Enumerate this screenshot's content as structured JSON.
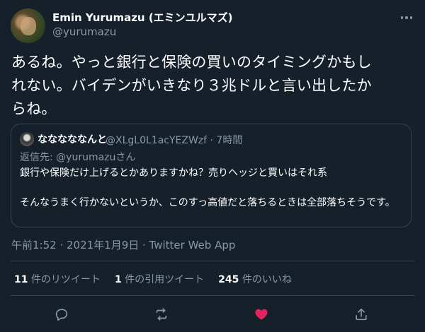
{
  "author": {
    "name": "Emin Yurumazu (エミンユルマズ)",
    "handle": "@yurumazu"
  },
  "tweet": {
    "lines": [
      "あるね。やっと銀行と保険の買いのタイミングかもし",
      "れない。バイデンがいきなり３兆ドルと言い出したか",
      "らね。"
    ]
  },
  "quote": {
    "name": "なななななんと",
    "handle_time": "@XLgL0L1acYEZWzf · 7時間",
    "reply_prefix": "返信先: ",
    "reply_mention": "@yurumazu",
    "reply_suffix": "さん",
    "paragraphs": [
      "銀行や保険だけ上げるとかありますかね？売りヘッジと買いはそれ系",
      "そんなうまく行かないというか、このすっ高値だと落ちるときは全部落ちそうです。"
    ]
  },
  "meta": {
    "timestamp": "午前1:52 · 2021年1月9日 · Twitter Web App"
  },
  "stats": {
    "retweets_count": "11",
    "retweets_label": " 件のリツイート",
    "quotes_count": "1",
    "quotes_label": " 件の引用ツイート",
    "likes_count": "245",
    "likes_label": " 件のいいね"
  },
  "icons": {
    "more": "more-horizontal-icon",
    "reply": "reply-icon",
    "retweet": "retweet-icon",
    "like": "heart-filled-icon",
    "share": "share-icon"
  },
  "colors": {
    "background": "#15202b",
    "secondary_text": "#8899a6",
    "border": "#38444d",
    "like": "#e0245e"
  }
}
